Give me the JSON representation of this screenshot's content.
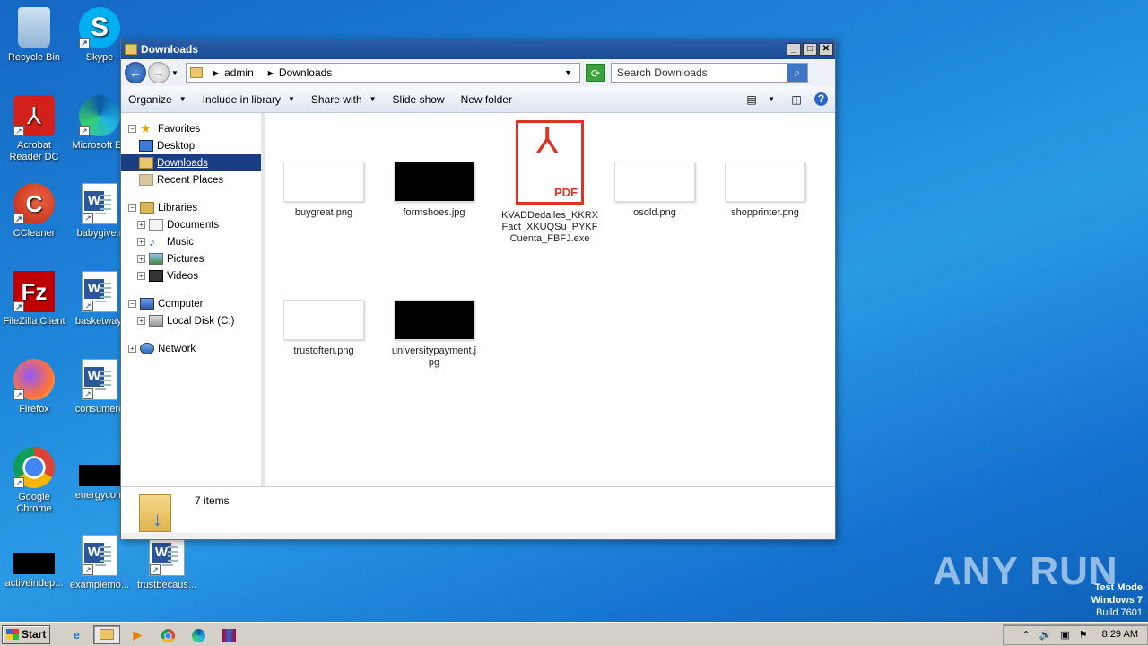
{
  "desktop": {
    "icons": [
      {
        "label": "Recycle Bin"
      },
      {
        "label": "Skype"
      },
      {
        "label": "Acrobat Reader DC"
      },
      {
        "label": "Microsoft Ed"
      },
      {
        "label": "CCleaner"
      },
      {
        "label": "babygive.r"
      },
      {
        "label": "FileZilla Client"
      },
      {
        "label": "basketway."
      },
      {
        "label": "Firefox"
      },
      {
        "label": "consumerd"
      },
      {
        "label": "Google Chrome"
      },
      {
        "label": "energycom"
      },
      {
        "label": "activeindep..."
      },
      {
        "label": "examplemo..."
      },
      {
        "label": "trustbecaus..."
      }
    ]
  },
  "window": {
    "title": "Downloads",
    "address": {
      "crumbs": [
        "admin",
        "Downloads"
      ]
    },
    "search_placeholder": "Search Downloads",
    "toolbar": {
      "organize": "Organize",
      "include_in_library": "Include in library",
      "share_with": "Share with",
      "slide_show": "Slide show",
      "new_folder": "New folder"
    },
    "nav": {
      "favorites": "Favorites",
      "desktop": "Desktop",
      "downloads": "Downloads",
      "recent_places": "Recent Places",
      "libraries": "Libraries",
      "documents": "Documents",
      "music": "Music",
      "pictures": "Pictures",
      "videos": "Videos",
      "computer": "Computer",
      "local_disk": "Local Disk (C:)",
      "network": "Network"
    },
    "files": [
      {
        "name": "buygreat.png"
      },
      {
        "name": "formshoes.jpg"
      },
      {
        "name": "KVADDedalles_KKRXFact_XKUQSu_PYKFCuenta_FBFJ.exe"
      },
      {
        "name": "osold.png"
      },
      {
        "name": "shopprinter.png"
      },
      {
        "name": "trustoften.png"
      },
      {
        "name": "universitypayment.jpg"
      }
    ],
    "status": "7 items"
  },
  "taskbar": {
    "start": "Start",
    "clock": "8:29 AM"
  },
  "watermark": "ANY RUN",
  "testmode": {
    "line1": "Test Mode",
    "line2": "Windows 7",
    "line3": "Build 7601"
  }
}
